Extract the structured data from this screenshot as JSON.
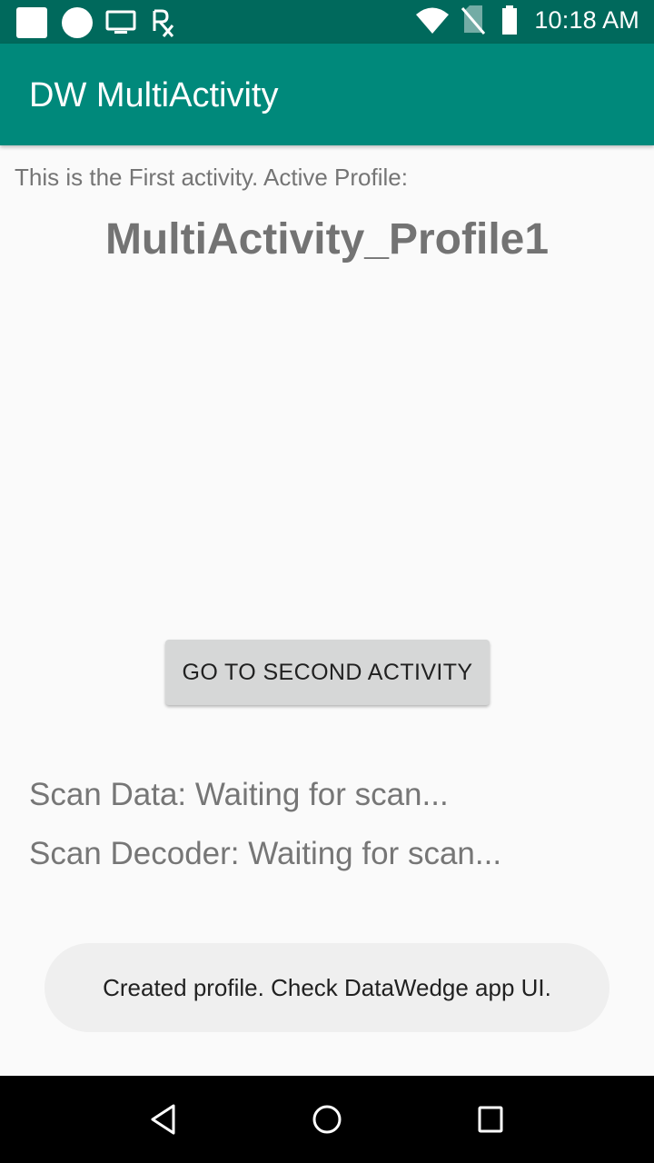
{
  "status_bar": {
    "time": "10:18 AM",
    "left_icons": [
      "app-square-icon",
      "app-circle-icon",
      "cast-screen-icon",
      "rx-icon"
    ],
    "right_icons": [
      "wifi-icon",
      "no-sim-icon",
      "battery-icon"
    ]
  },
  "app_bar": {
    "title": "DW MultiActivity",
    "color": "#00897b"
  },
  "main": {
    "intro": "This is the First activity. Active Profile:",
    "profile_name": "MultiActivity_Profile1",
    "go_button_label": "GO TO SECOND ACTIVITY",
    "scan_data": "Scan Data: Waiting for scan...",
    "scan_decoder": "Scan Decoder: Waiting for scan..."
  },
  "toast": {
    "message": "Created profile.  Check DataWedge app UI."
  },
  "nav_bar": {
    "buttons": [
      "back-icon",
      "home-icon",
      "recents-icon"
    ]
  }
}
